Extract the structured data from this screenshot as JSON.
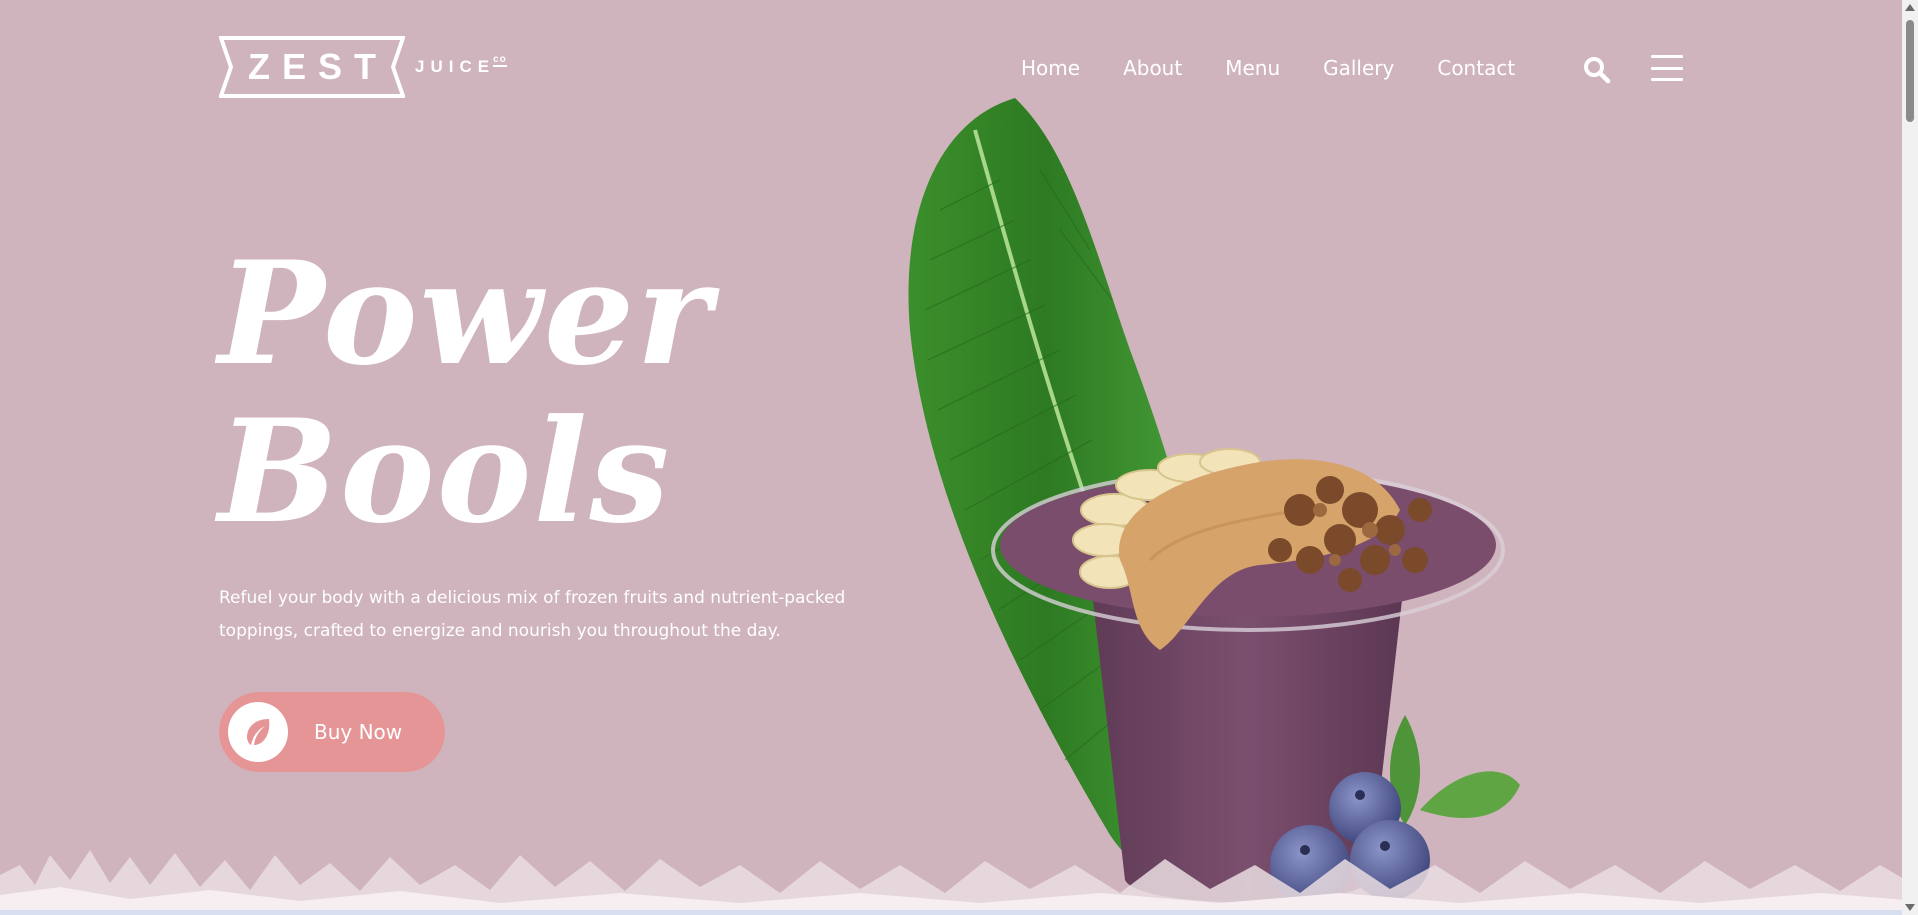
{
  "brand": {
    "name": "ZEST",
    "sub": "JUICE",
    "co": "co"
  },
  "nav": {
    "items": [
      {
        "label": "Home"
      },
      {
        "label": "About"
      },
      {
        "label": "Menu"
      },
      {
        "label": "Gallery"
      },
      {
        "label": "Contact"
      }
    ],
    "search_icon": "search-icon",
    "menu_icon": "hamburger-menu-icon"
  },
  "hero": {
    "title_line1": "Power",
    "title_line2": "Bools",
    "description": "Refuel your body with a delicious mix of frozen fruits and nutrient-packed toppings, crafted to energize and nourish you throughout the day.",
    "cta_label": "Buy Now",
    "cta_icon": "leaf-icon"
  },
  "colors": {
    "background": "#cfb3bd",
    "button": "#e69597",
    "text": "#ffffff"
  }
}
